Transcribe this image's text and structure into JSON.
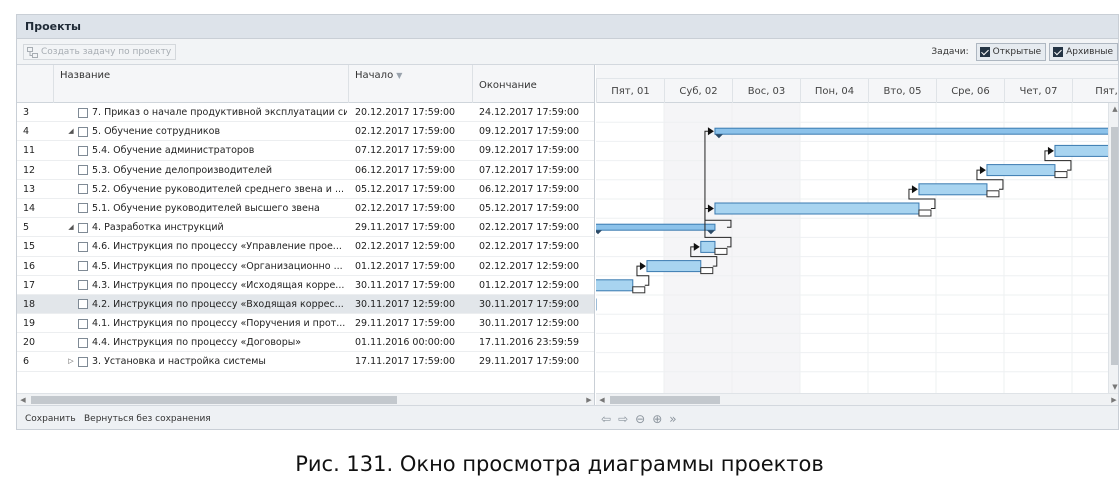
{
  "window": {
    "title": "Проекты"
  },
  "toolbar": {
    "create_task_label": "Создать задачу по проекту",
    "tasks_label": "Задачи:",
    "open_label": "Открытые",
    "archive_label": "Архивные"
  },
  "grid": {
    "columns": {
      "name": "Название",
      "start": "Начало",
      "end": "Окончание"
    },
    "rows": [
      {
        "num": "3",
        "expander": "",
        "indent": 2,
        "name": "7. Приказ о начале продуктивной эксплуатации си...",
        "start": "20.12.2017 17:59:00",
        "end": "24.12.2017 17:59:00"
      },
      {
        "num": "4",
        "expander": "expanded",
        "indent": 1,
        "name": "5. Обучение сотрудников",
        "start": "02.12.2017 17:59:00",
        "end": "09.12.2017 17:59:00"
      },
      {
        "num": "11",
        "expander": "",
        "indent": 2,
        "name": "5.4. Обучение администраторов",
        "start": "07.12.2017 17:59:00",
        "end": "09.12.2017 17:59:00"
      },
      {
        "num": "12",
        "expander": "",
        "indent": 2,
        "name": "5.3. Обучение делопроизводителей",
        "start": "06.12.2017 17:59:00",
        "end": "07.12.2017 17:59:00"
      },
      {
        "num": "13",
        "expander": "",
        "indent": 2,
        "name": "5.2. Обучение руководителей среднего звена и ...",
        "start": "05.12.2017 17:59:00",
        "end": "06.12.2017 17:59:00"
      },
      {
        "num": "14",
        "expander": "",
        "indent": 2,
        "name": "5.1. Обучение руководителей высшего звена",
        "start": "02.12.2017 17:59:00",
        "end": "05.12.2017 17:59:00"
      },
      {
        "num": "5",
        "expander": "expanded",
        "indent": 1,
        "name": "4. Разработка инструкций",
        "start": "29.11.2017 17:59:00",
        "end": "02.12.2017 17:59:00"
      },
      {
        "num": "15",
        "expander": "",
        "indent": 2,
        "name": "4.6. Инструкция по процессу «Управление прое...",
        "start": "02.12.2017 12:59:00",
        "end": "02.12.2017 17:59:00"
      },
      {
        "num": "16",
        "expander": "",
        "indent": 2,
        "name": "4.5. Инструкция по процессу «Организационно ...",
        "start": "01.12.2017 17:59:00",
        "end": "02.12.2017 12:59:00"
      },
      {
        "num": "17",
        "expander": "",
        "indent": 2,
        "name": "4.3. Инструкция по процессу «Исходящая корре...",
        "start": "30.11.2017 17:59:00",
        "end": "01.12.2017 12:59:00"
      },
      {
        "num": "18",
        "expander": "",
        "indent": 2,
        "name": "4.2. Инструкция по процессу «Входящая коррес...",
        "start": "30.11.2017 12:59:00",
        "end": "30.11.2017 17:59:00",
        "selected": true
      },
      {
        "num": "19",
        "expander": "",
        "indent": 2,
        "name": "4.1. Инструкция по процессу «Поручения и прот...",
        "start": "29.11.2017 17:59:00",
        "end": "30.11.2017 12:59:00"
      },
      {
        "num": "20",
        "expander": "",
        "indent": 2,
        "name": "4.4. Инструкция по процессу «Договоры»",
        "start": "01.11.2016 00:00:00",
        "end": "17.11.2016 23:59:59"
      },
      {
        "num": "6",
        "expander": "collapsed",
        "indent": 1,
        "name": "3. Установка и настройка системы",
        "start": "17.11.2017 17:59:00",
        "end": "29.11.2017 17:59:00"
      }
    ]
  },
  "gantt": {
    "days": [
      "Пят, 01",
      "Суб, 02",
      "Вос, 03",
      "Пон, 04",
      "Вто, 05",
      "Сре, 06",
      "Чет, 07",
      "Пят,"
    ],
    "weekend_days": [
      1,
      2
    ],
    "bar_color": "#a8d4f0",
    "bar_border": "#3a7ab0",
    "summary_color": "#8cc2ea"
  },
  "footer": {
    "save_label": "Сохранить",
    "revert_label": "Вернуться без сохранения"
  },
  "caption": "Рис. 131. Окно просмотра диаграммы проектов"
}
